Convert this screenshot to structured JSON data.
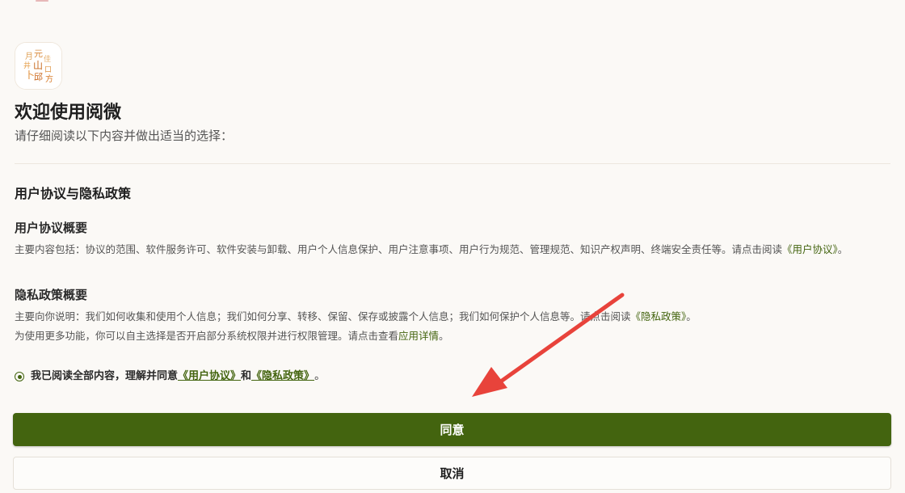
{
  "app": {
    "logo_name": "yuewei-app-logo"
  },
  "header": {
    "title": "欢迎使用阅微",
    "subtitle": "请仔细阅读以下内容并做出适当的选择："
  },
  "agreement": {
    "section_title": "用户协议与隐私政策",
    "terms_heading": "用户协议概要",
    "terms_text": "主要内容包括：协议的范围、软件服务许可、软件安装与卸载、用户个人信息保护、用户注意事项、用户行为规范、管理规范、知识产权声明、终端安全责任等。请点击阅读",
    "terms_link": "《用户协议》",
    "terms_end": "。",
    "privacy_heading": "隐私政策概要",
    "privacy_text": "主要向你说明：我们如何收集和使用个人信息；我们如何分享、转移、保留、保存或披露个人信息；我们如何保护个人信息等。请点击阅读",
    "privacy_link": "《隐私政策》",
    "privacy_end": "。",
    "permission_text": "为使用更多功能，你可以自主选择是否开启部分系统权限并进行权限管理。请点击查看",
    "permission_link": "应用详情",
    "permission_end": "。"
  },
  "consent": {
    "text": "我已阅读全部内容，理解并同意",
    "terms_link": "《用户协议》",
    "and": "和",
    "privacy_link": "《隐私政策》",
    "end": "。",
    "checked": true
  },
  "buttons": {
    "agree": "同意",
    "cancel": "取消"
  },
  "colors": {
    "accent": "#43640f",
    "background": "#fbf9f6",
    "annotation_arrow": "#e8433b"
  }
}
